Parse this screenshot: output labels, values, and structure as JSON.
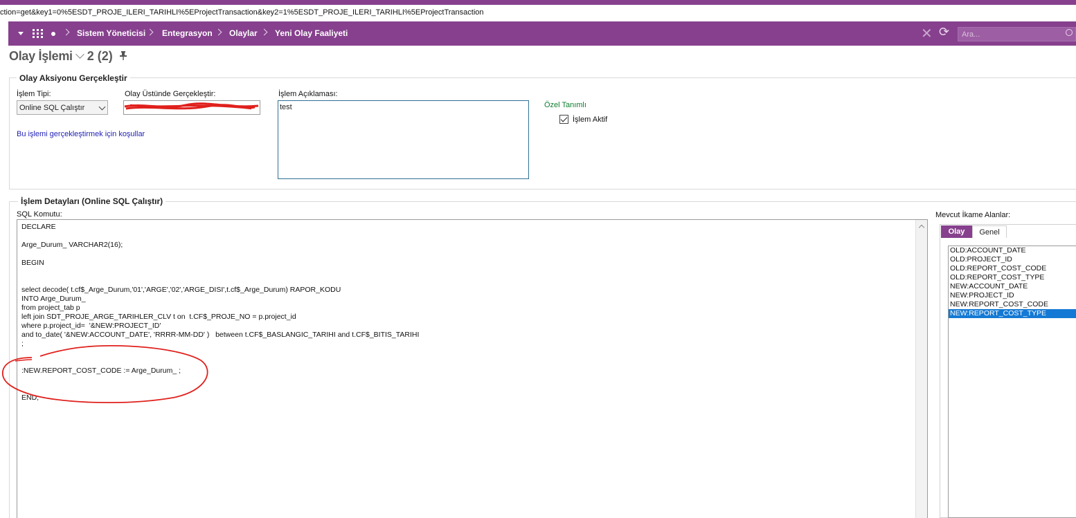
{
  "url": "ction=get&key1=0%5ESDT_PROJE_ILERI_TARIHLI%5EProjectTransaction&key2=1%5ESDT_PROJE_ILERI_TARIHLI%5EProjectTransaction",
  "nav": {
    "breadcrumb": [
      "Sistem Yöneticisi",
      "Entegrasyon",
      "Olaylar",
      "Yeni Olay Faaliyeti"
    ],
    "search_placeholder": "Ara..."
  },
  "page": {
    "title": "Olay İşlemi",
    "counter": "2 (2)"
  },
  "action_group": {
    "legend": "Olay Aksiyonu Gerçekleştir",
    "islem_tipi_label": "İşlem Tipi:",
    "islem_tipi_value": "Online SQL Çalıştır",
    "olay_uzerinde_label": "Olay Üstünde Gerçekleştir:",
    "olay_uzerinde_value": "",
    "aciklama_label": "İşlem Açıklaması:",
    "aciklama_value": "test",
    "conditions_link": "Bu işlemi gerçekleştirmek için koşullar",
    "ozel_tanimli": "Özel Tanımlı",
    "islem_aktif_label": "İşlem Aktif",
    "islem_aktif_checked": true
  },
  "details_group": {
    "legend": "İşlem Detayları (Online SQL Çalıştır)",
    "sql_label": "SQL Komutu:",
    "sql_text": "DECLARE\n\nArge_Durum_ VARCHAR2(16);\n\nBEGIN\n\n\nselect decode( t.cf$_Arge_Durum,'01','ARGE','02','ARGE_DISI',t.cf$_Arge_Durum) RAPOR_KODU\nINTO Arge_Durum_\nfrom project_tab p\nleft join SDT_PROJE_ARGE_TARIHLER_CLV t on  t.CF$_PROJE_NO = p.project_id\nwhere p.project_id=  '&NEW:PROJECT_ID'\nand to_date( '&NEW:ACCOUNT_DATE', 'RRRR-MM-DD' )   between t.CF$_BASLANGIC_TARIHI and t.CF$_BITIS_TARIHI\n;\n\n\n:NEW.REPORT_COST_CODE := Arge_Durum_ ;\n\n\nEND;"
  },
  "substitution": {
    "label": "Mevcut İkame Alanlar:",
    "tabs": [
      "Olay",
      "Genel"
    ],
    "active_tab": "Olay",
    "items": [
      "OLD:ACCOUNT_DATE",
      "OLD:PROJECT_ID",
      "OLD:REPORT_COST_CODE",
      "OLD:REPORT_COST_TYPE",
      "NEW:ACCOUNT_DATE",
      "NEW:PROJECT_ID",
      "NEW:REPORT_COST_CODE",
      "NEW:REPORT_COST_TYPE"
    ],
    "selected_item": "NEW:REPORT_COST_TYPE"
  },
  "colors": {
    "brand": "#86408d",
    "link": "#1f1fb5",
    "green": "#0a7d2d",
    "selection": "#1479d4",
    "annotation": "#e0201c"
  },
  "icons": [
    "caret-down-icon",
    "grid-menu-icon",
    "dot-icon",
    "chevron-right-icon",
    "close-icon",
    "refresh-icon",
    "search-icon",
    "pin-icon",
    "checkbox-icon",
    "scroll-up-icon"
  ]
}
